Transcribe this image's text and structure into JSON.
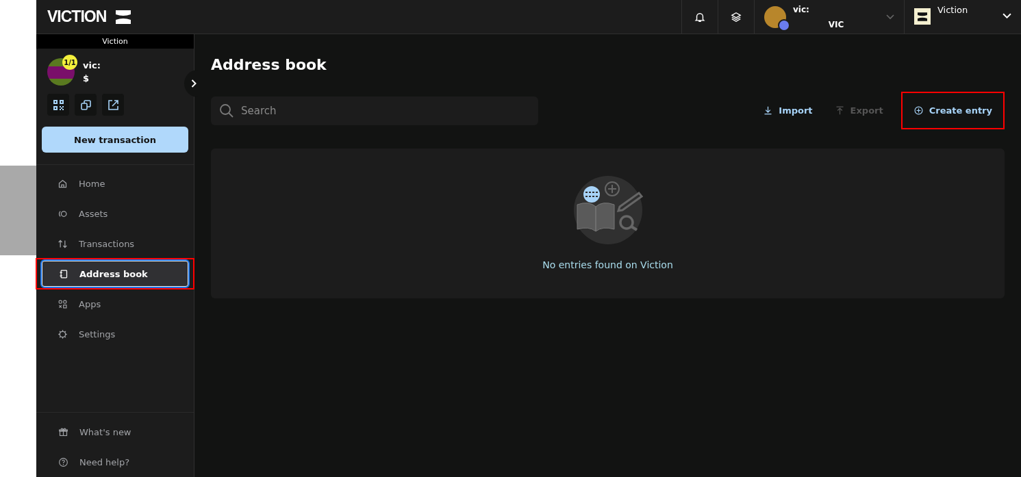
{
  "header": {
    "logo": "VICTION",
    "account": {
      "name": "vic:",
      "currency": "VIC"
    },
    "network": {
      "name": "Viction"
    }
  },
  "sidebar": {
    "network_banner": "Viction",
    "safe": {
      "name": "vic:",
      "balance": "$",
      "threshold": "1/1"
    },
    "new_transaction": "New transaction",
    "nav": [
      {
        "label": "Home",
        "kind": "home",
        "selected": false,
        "highlighted": false
      },
      {
        "label": "Assets",
        "kind": "assets",
        "selected": false,
        "highlighted": false
      },
      {
        "label": "Transactions",
        "kind": "transactions",
        "selected": false,
        "highlighted": false
      },
      {
        "label": "Address book",
        "kind": "book",
        "selected": true,
        "highlighted": true
      },
      {
        "label": "Apps",
        "kind": "apps",
        "selected": false,
        "highlighted": false
      },
      {
        "label": "Settings",
        "kind": "settings",
        "selected": false,
        "highlighted": false
      }
    ],
    "footer": [
      {
        "label": "What's new",
        "kind": "gift"
      },
      {
        "label": "Need help?",
        "kind": "help"
      }
    ]
  },
  "main": {
    "title": "Address book",
    "search": {
      "placeholder": "Search"
    },
    "actions": [
      {
        "label": "Import",
        "kind": "import",
        "disabled": false,
        "highlighted": false
      },
      {
        "label": "Export",
        "kind": "export",
        "disabled": true,
        "highlighted": false
      },
      {
        "label": "Create entry",
        "kind": "create",
        "disabled": false,
        "highlighted": true
      }
    ],
    "empty_message": "No entries found on Viction"
  }
}
